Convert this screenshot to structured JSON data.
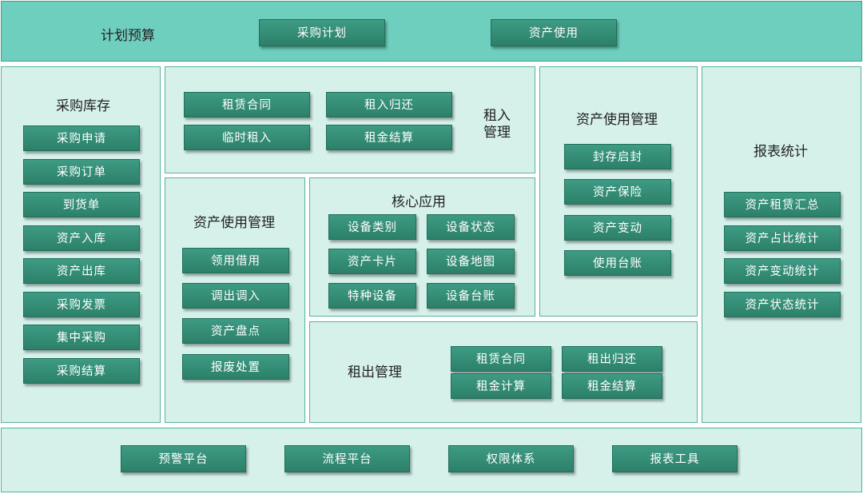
{
  "plan": {
    "title": "计划预算",
    "buttons": [
      "采购计划",
      "资产使用"
    ]
  },
  "purchase": {
    "title": "采购库存",
    "buttons": [
      "采购申请",
      "采购订单",
      "到货单",
      "资产入库",
      "资产出库",
      "采购发票",
      "集中采购",
      "采购结算"
    ]
  },
  "rent_in": {
    "title_line1": "租入",
    "title_line2": "管理",
    "buttons": [
      "租赁合同",
      "租入归还",
      "临时租入",
      "租金结算"
    ]
  },
  "asset_mgmt_right": {
    "title": "资产使用管理",
    "buttons": [
      "封存启封",
      "资产保险",
      "资产变动",
      "使用台账"
    ]
  },
  "report": {
    "title": "报表统计",
    "buttons": [
      "资产租赁汇总",
      "资产占比统计",
      "资产变动统计",
      "资产状态统计"
    ]
  },
  "asset_mgmt_left": {
    "title": "资产使用管理",
    "buttons": [
      "领用借用",
      "调出调入",
      "资产盘点",
      "报废处置"
    ]
  },
  "core": {
    "title": "核心应用",
    "buttons": [
      "设备类别",
      "设备状态",
      "资产卡片",
      "设备地图",
      "特种设备",
      "设备台账"
    ]
  },
  "rent_out": {
    "title": "租出管理",
    "buttons": [
      "租赁合同",
      "租出归还",
      "租金计算",
      "租金结算"
    ]
  },
  "platform": {
    "buttons": [
      "预警平台",
      "流程平台",
      "权限体系",
      "报表工具"
    ]
  }
}
